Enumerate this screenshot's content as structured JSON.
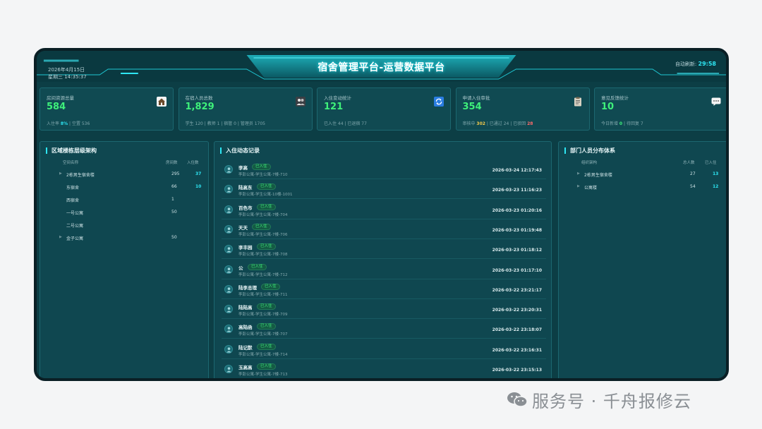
{
  "header": {
    "date": "2026年4月15日",
    "weekday_time": "星期三 14:35:37",
    "title": "宿舍管理平台-运营数据平台",
    "refresh_label": "自动刷新:",
    "refresh_countdown": "29:58"
  },
  "cards": [
    {
      "label": "房间资源总量",
      "value": "584",
      "icon": "house-icon",
      "sub": [
        {
          "t": "入住率 "
        },
        {
          "t": "8%",
          "c": "cyan"
        },
        {
          "t": " | 空置 536"
        }
      ]
    },
    {
      "label": "在宿人员总数",
      "value": "1,829",
      "icon": "people-icon",
      "sub": [
        {
          "t": "学生 120 | 教师 1 | 宿管 0 | 管理员 1705"
        }
      ]
    },
    {
      "label": "入住变动统计",
      "value": "121",
      "icon": "refresh-icon",
      "sub": [
        {
          "t": "已入住 44 | 已退宿 77"
        }
      ]
    },
    {
      "label": "申请入住审批",
      "value": "354",
      "icon": "clipboard-icon",
      "sub": [
        {
          "t": "审核中 "
        },
        {
          "t": "302",
          "c": "yellow"
        },
        {
          "t": " | 已通过 24 | 已驳回 "
        },
        {
          "t": "28",
          "c": "red"
        }
      ]
    },
    {
      "label": "意见反馈统计",
      "value": "10",
      "icon": "chat-icon",
      "sub": [
        {
          "t": "今日新增 "
        },
        {
          "t": "0",
          "c": "green"
        },
        {
          "t": " | 待回复 7"
        }
      ]
    }
  ],
  "building_panel": {
    "title": "区域楼栋层级架构",
    "col_name": "空间名称",
    "col_rooms": "房间数",
    "col_occupied": "入住数",
    "rows": [
      {
        "name": "2栋男生宿舍楼",
        "rooms": "295",
        "occupied": "37",
        "expand": true
      },
      {
        "name": "东宿舍",
        "rooms": "66",
        "occupied": "10",
        "expand": false
      },
      {
        "name": "西宿舍",
        "rooms": "1",
        "occupied": "",
        "expand": false
      },
      {
        "name": "一号公寓",
        "rooms": "50",
        "occupied": "",
        "expand": false
      },
      {
        "name": "二号公寓",
        "rooms": "",
        "occupied": "",
        "expand": false
      },
      {
        "name": "金子公寓",
        "rooms": "50",
        "occupied": "",
        "expand": true
      }
    ]
  },
  "records_panel": {
    "title": "入住动态记录",
    "records": [
      {
        "name": "李高",
        "status": "已入住",
        "location": "李彭公寓-学生公寓-7楼-710",
        "time": "2026-03-24 12:17:43"
      },
      {
        "name": "陆高东",
        "status": "已入住",
        "location": "李彭公寓-学生公寓-10楼-1001",
        "time": "2026-03-23 11:16:23"
      },
      {
        "name": "百色市",
        "status": "已入住",
        "location": "李彭公寓-学生公寓-7楼-704",
        "time": "2026-03-23 01:20:16"
      },
      {
        "name": "天天",
        "status": "已入住",
        "location": "李彭公寓-学生公寓-7楼-706",
        "time": "2026-03-23 01:19:48"
      },
      {
        "name": "李丰园",
        "status": "已入住",
        "location": "李彭公寓-学生公寓-7楼-708",
        "time": "2026-03-23 01:18:12"
      },
      {
        "name": "公",
        "status": "已入住",
        "location": "李彭公寓-学生公寓-7楼-712",
        "time": "2026-03-23 01:17:10"
      },
      {
        "name": "陆李总理",
        "status": "已入住",
        "location": "李彭公寓-学生公寓-7楼-711",
        "time": "2026-03-22 23:21:17"
      },
      {
        "name": "陆陆高",
        "status": "已入住",
        "location": "李彭公寓-学生公寓-7楼-709",
        "time": "2026-03-22 23:20:31"
      },
      {
        "name": "高陆函",
        "status": "已入住",
        "location": "李彭公寓-学生公寓-7楼-707",
        "time": "2026-03-22 23:18:07"
      },
      {
        "name": "陆记默",
        "status": "已入住",
        "location": "李彭公寓-学生公寓-7楼-714",
        "time": "2026-03-22 23:16:31"
      },
      {
        "name": "玉高高",
        "status": "已入住",
        "location": "李彭公寓-学生公寓-7楼-713",
        "time": "2026-03-22 23:15:13"
      }
    ]
  },
  "dept_panel": {
    "title": "部门人员分布体系",
    "col_name": "组织架构",
    "col_total": "总人数",
    "col_occupied": "已入住",
    "rows": [
      {
        "name": "2栋男生宿舍楼",
        "total": "27",
        "occupied": "13"
      },
      {
        "name": "公寓楼",
        "total": "54",
        "occupied": "12"
      }
    ]
  },
  "watermark": {
    "text": "服务号 · 千舟报修云"
  }
}
